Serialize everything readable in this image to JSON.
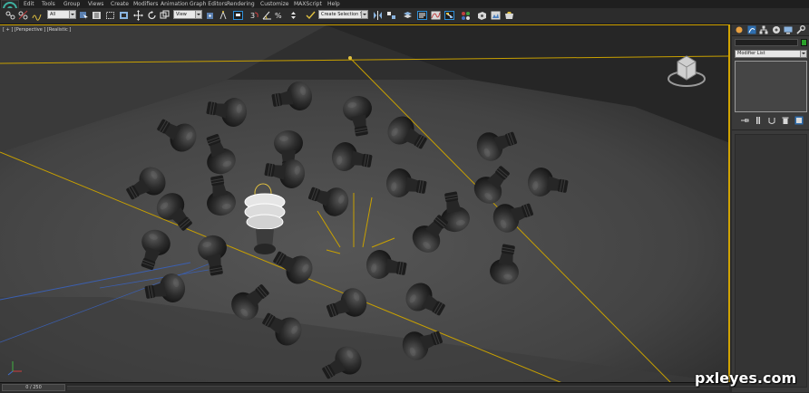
{
  "menu": {
    "items": [
      "Edit",
      "Tools",
      "Group",
      "Views",
      "Create",
      "Modifiers",
      "Animation",
      "Graph Editors",
      "Rendering",
      "Customize",
      "MAXScript",
      "Help"
    ]
  },
  "toolbar": {
    "selection_filter": "All",
    "reference_coord": "View",
    "named_selection": "Create Selection Set"
  },
  "viewport": {
    "label": "[ + ] [Perspective ] [Realistic ]"
  },
  "command_panel": {
    "modifier_list": "Modifier List"
  },
  "timeline": {
    "frame": "0 / 250"
  },
  "watermark": "pxleyes.com",
  "colors": {
    "accent": "#d1a300",
    "object_color": "#2aa02a"
  }
}
